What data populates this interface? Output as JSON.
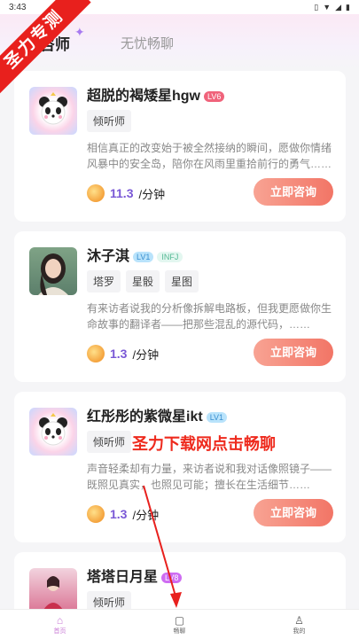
{
  "status_bar": {
    "time": "3:43"
  },
  "header": {
    "tabs": [
      {
        "label": "咨询师"
      },
      {
        "label": "无忧畅聊"
      }
    ],
    "active_tab_visible": "咨师"
  },
  "watermark": {
    "text": "圣力专测"
  },
  "counselors": [
    {
      "name": "超脱的褐矮星hgw",
      "level": "LV6",
      "mbti": "",
      "tags": [
        "倾听师"
      ],
      "description": "相信真正的改变始于被全然接纳的瞬间，愿做你情绪风暴中的安全岛，陪你在风雨里重拾前行的勇气……",
      "price": "11.3",
      "unit": "/分钟",
      "button": "立即咨询"
    },
    {
      "name": "沐子淇",
      "level": "LV1",
      "mbti": "INFJ",
      "tags": [
        "塔罗",
        "星骰",
        "星图"
      ],
      "description": "有来访者说我的分析像拆解电路板，但我更愿做你生命故事的翻译者——把那些混乱的源代码，……",
      "price": "1.3",
      "unit": "/分钟",
      "button": "立即咨询"
    },
    {
      "name": "红彤彤的紫微星ikt",
      "level": "LV1",
      "mbti": "",
      "tags": [
        "倾听师"
      ],
      "description": "声音轻柔却有力量，来访者说和我对话像照镜子——既照见真实，也照见可能；擅长在生活细节……",
      "price": "1.3",
      "unit": "/分钟",
      "button": "立即咨询"
    },
    {
      "name": "塔塔日月星",
      "level": "LV8",
      "mbti": "",
      "tags": [
        "倾听师"
      ],
      "description": "",
      "price": "",
      "unit": "",
      "button": ""
    }
  ],
  "overlay": {
    "text": "圣力下载网点击畅聊"
  },
  "bottom_nav": [
    {
      "label": "首页",
      "icon": "home-icon"
    },
    {
      "label": "畅聊",
      "icon": "chat-icon"
    },
    {
      "label": "我的",
      "icon": "user-icon"
    }
  ],
  "colors": {
    "accent_button": "#f27566",
    "price_text": "#7a58d6",
    "watermark": "#e8201d",
    "overlay_red": "#ee2a1d"
  }
}
